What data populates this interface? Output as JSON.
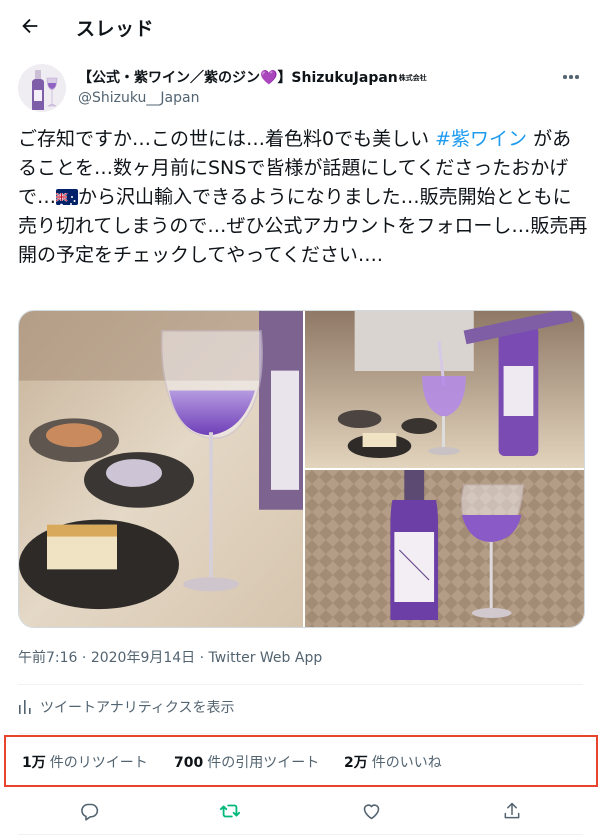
{
  "header": {
    "title": "スレッド",
    "back_icon": "arrow-left-icon"
  },
  "author": {
    "display_name_prefix": "【公式・紫ワイン／紫のジン",
    "display_name_heart": "💜",
    "display_name_suffix": "】ShizukuJapan",
    "display_name_badge": "株式会社",
    "handle": "@Shizuku__Japan",
    "more_icon": "more-horizontal-icon"
  },
  "tweet": {
    "text_part1": "ご存知ですか…この世には…着色料0でも美しい ",
    "hashtag": "#紫ワイン",
    "text_part2": " があることを…数ヶ月前にSNSで皆様が話題にしてくださったおかげで…",
    "flag_icon": "australia-flag-icon",
    "text_part3": "から沢山輸入できるようになりました…販売開始とともに売り切れてしまうので…ぜひ公式アカウントをフォローし…販売再開の予定をチェックしてやってください…."
  },
  "meta": {
    "time": "午前7:16",
    "separator1": " · ",
    "date": "2020年9月14日",
    "separator2": " · ",
    "source": "Twitter Web App"
  },
  "analytics": {
    "icon": "bar-chart-icon",
    "label": "ツイートアナリティクスを表示"
  },
  "stats": {
    "retweets_count": "1万",
    "retweets_label": "件のリツイート",
    "quotes_count": "700",
    "quotes_label": "件の引用ツイート",
    "likes_count": "2万",
    "likes_label": "件のいいね"
  },
  "actions": {
    "reply_icon": "reply-icon",
    "retweet_icon": "retweet-icon",
    "like_icon": "heart-icon",
    "share_icon": "share-icon"
  },
  "colors": {
    "link": "#1d9bf0",
    "secondary_text": "#536471",
    "highlight_border": "#e8442b",
    "retweet_green": "#00ba7c"
  }
}
